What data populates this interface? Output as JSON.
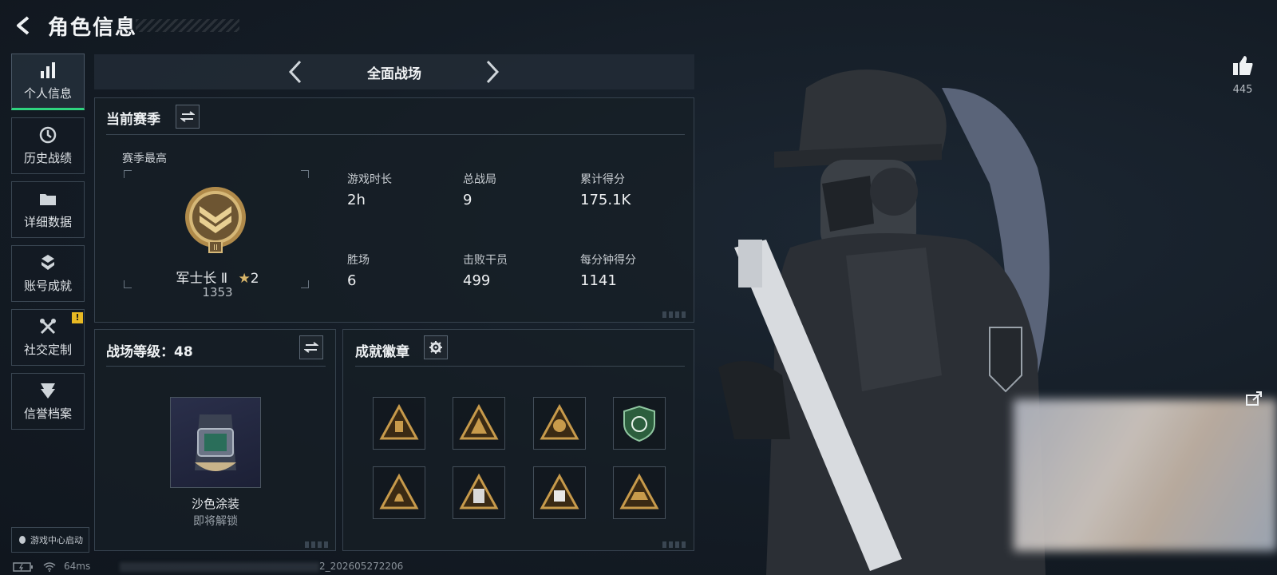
{
  "header": {
    "title": "角色信息"
  },
  "sidebar": {
    "items": [
      {
        "label": "个人信息",
        "icon": "bar-chart-icon",
        "active": true
      },
      {
        "label": "历史战绩",
        "icon": "history-icon"
      },
      {
        "label": "详细数据",
        "icon": "folder-icon"
      },
      {
        "label": "账号成就",
        "icon": "achievement-icon"
      },
      {
        "label": "社交定制",
        "icon": "tools-icon",
        "badge": "!"
      },
      {
        "label": "信誉档案",
        "icon": "credit-icon"
      }
    ],
    "game_center_label": "游戏中心启动"
  },
  "mode": {
    "current": "全面战场"
  },
  "season": {
    "title": "当前赛季",
    "best_label": "赛季最高",
    "rank_name": "军士长 Ⅱ",
    "rank_stars": "2",
    "rank_points": "1353",
    "stats": [
      {
        "label": "游戏时长",
        "value": "2h"
      },
      {
        "label": "总战局",
        "value": "9"
      },
      {
        "label": "累计得分",
        "value": "175.1K"
      },
      {
        "label": "胜场",
        "value": "6"
      },
      {
        "label": "击败干员",
        "value": "499"
      },
      {
        "label": "每分钟得分",
        "value": "1141"
      }
    ]
  },
  "battle_level": {
    "title": "战场等级：48",
    "reward_name": "沙色涂装",
    "reward_status": "即将解锁"
  },
  "badges": {
    "title": "成就徽章",
    "items": [
      {
        "icon": "bronze-triangle-badge-1",
        "color": "#c79a4b"
      },
      {
        "icon": "bronze-triangle-badge-2",
        "color": "#c79a4b"
      },
      {
        "icon": "bronze-triangle-badge-3",
        "color": "#c79a4b"
      },
      {
        "icon": "green-shield-badge",
        "color": "#3f8a57"
      },
      {
        "icon": "bronze-triangle-badge-4",
        "color": "#c79a4b"
      },
      {
        "icon": "bronze-triangle-badge-5",
        "color": "#c79a4b"
      },
      {
        "icon": "bronze-triangle-badge-6",
        "color": "#c79a4b"
      },
      {
        "icon": "bronze-triangle-badge-7",
        "color": "#c79a4b"
      }
    ]
  },
  "social": {
    "likes": "445"
  },
  "status": {
    "ping": "64ms",
    "session": "2_202605272206"
  },
  "colors": {
    "accent": "#2fd47f",
    "warn": "#e8b923",
    "bronze": "#c79a4b"
  }
}
